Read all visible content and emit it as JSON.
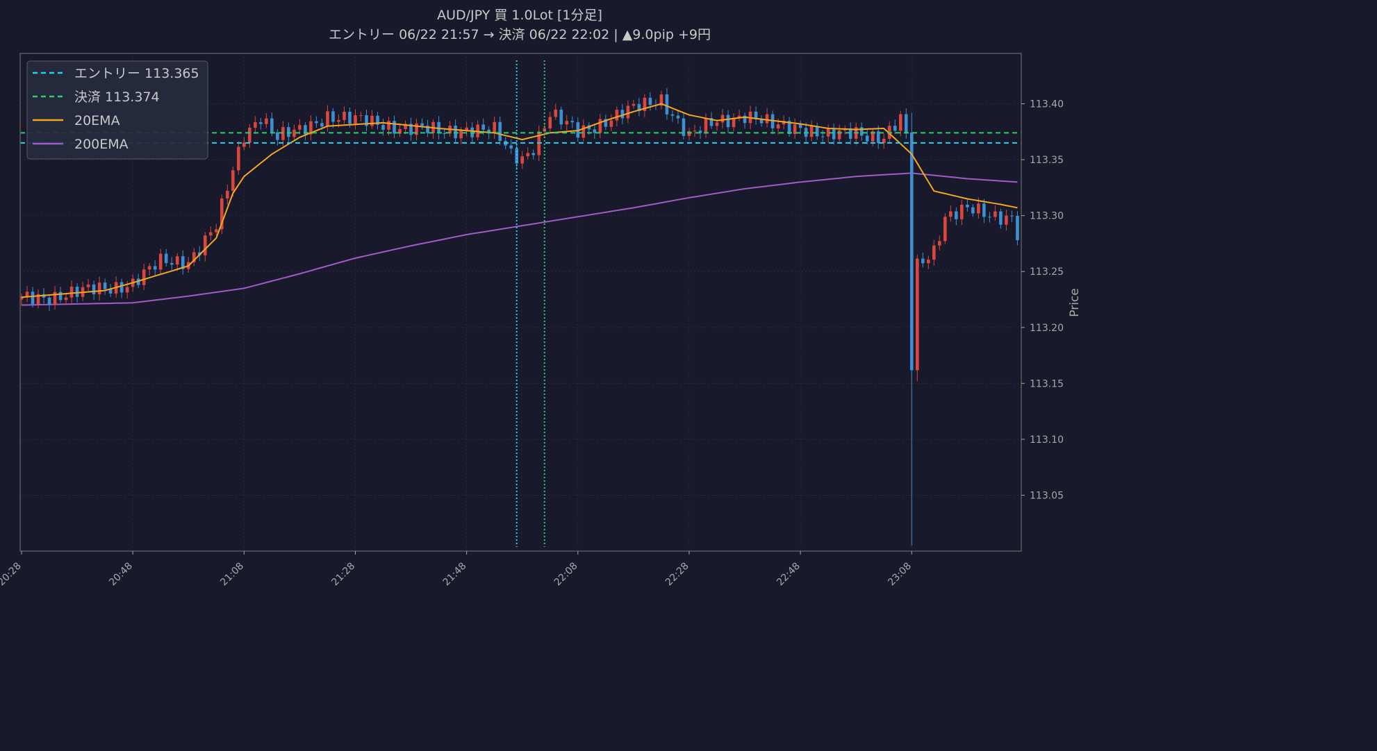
{
  "colors": {
    "background": "#181a2b",
    "plot_border": "#5a5a5a",
    "grid": "#2c2f44",
    "text": "#c9c9c9",
    "tick_text": "#a8a8a8",
    "bull": "#d9473f",
    "bear": "#3f8fd0",
    "entry": "#22d3ee",
    "exit": "#2ecc71",
    "ema20": "#f5a623",
    "ema200": "#a05cc8",
    "legend_bg": "#262a3d",
    "legend_border": "#55596b"
  },
  "chart_data": {
    "type": "candlestick",
    "title": "AUD/JPY 買 1.0Lot [1分足]",
    "subtitle": "エントリー 06/22 21:57 → 決済 06/22 22:02 | ▲9.0pip +9円",
    "xlabel": "",
    "ylabel": "Price",
    "ylim": [
      113.0,
      113.445
    ],
    "y_ticks": [
      113.05,
      113.1,
      113.15,
      113.2,
      113.25,
      113.3,
      113.35,
      113.4
    ],
    "y_tick_labels": [
      "113.05",
      "113.10",
      "113.15",
      "113.20",
      "113.25",
      "113.30",
      "113.35",
      "113.40"
    ],
    "x_start_time": "20:28",
    "x_ticks": [
      "20:28",
      "20:48",
      "21:08",
      "21:28",
      "21:48",
      "22:08",
      "22:28",
      "22:48",
      "23:08"
    ],
    "grid": true,
    "legend_position": "top-left",
    "legend": [
      {
        "label": "エントリー 113.365",
        "style": "dashed",
        "color_key": "entry"
      },
      {
        "label": "決済 113.374",
        "style": "dashed",
        "color_key": "exit"
      },
      {
        "label": "20EMA",
        "style": "solid",
        "color_key": "ema20"
      },
      {
        "label": "200EMA",
        "style": "solid",
        "color_key": "ema200"
      }
    ],
    "entry_price": 113.365,
    "exit_price": 113.374,
    "entry_time": "21:57",
    "exit_time": "22:02",
    "close_anchors": [
      [
        "20:28",
        113.225
      ],
      [
        "20:33",
        113.228
      ],
      [
        "20:38",
        113.231
      ],
      [
        "20:43",
        113.235
      ],
      [
        "20:48",
        113.24
      ],
      [
        "20:53",
        113.258
      ],
      [
        "20:58",
        113.26
      ],
      [
        "21:03",
        113.29
      ],
      [
        "21:06",
        113.34
      ],
      [
        "21:08",
        113.372
      ],
      [
        "21:11",
        113.39
      ],
      [
        "21:14",
        113.37
      ],
      [
        "21:18",
        113.375
      ],
      [
        "21:23",
        113.39
      ],
      [
        "21:28",
        113.385
      ],
      [
        "21:33",
        113.382
      ],
      [
        "21:38",
        113.378
      ],
      [
        "21:43",
        113.375
      ],
      [
        "21:48",
        113.378
      ],
      [
        "21:53",
        113.375
      ],
      [
        "21:56",
        113.355
      ],
      [
        "21:58",
        113.352
      ],
      [
        "22:00",
        113.362
      ],
      [
        "22:03",
        113.39
      ],
      [
        "22:08",
        113.375
      ],
      [
        "22:13",
        113.385
      ],
      [
        "22:18",
        113.395
      ],
      [
        "22:23",
        113.405
      ],
      [
        "22:28",
        113.37
      ],
      [
        "22:33",
        113.385
      ],
      [
        "22:38",
        113.39
      ],
      [
        "22:43",
        113.38
      ],
      [
        "22:48",
        113.38
      ],
      [
        "22:53",
        113.37
      ],
      [
        "22:58",
        113.375
      ],
      [
        "23:03",
        113.37
      ],
      [
        "23:06",
        113.385
      ],
      [
        "23:07",
        113.37
      ],
      [
        "23:08",
        113.165
      ],
      [
        "23:09",
        113.255
      ],
      [
        "23:12",
        113.27
      ],
      [
        "23:14",
        113.3
      ],
      [
        "23:18",
        113.305
      ],
      [
        "23:22",
        113.3
      ],
      [
        "23:26",
        113.3
      ],
      [
        "23:27",
        113.285
      ]
    ],
    "ema20_anchors": [
      [
        "20:28",
        113.227
      ],
      [
        "20:43",
        113.233
      ],
      [
        "20:48",
        113.24
      ],
      [
        "20:58",
        113.255
      ],
      [
        "21:03",
        113.28
      ],
      [
        "21:06",
        113.32
      ],
      [
        "21:08",
        113.335
      ],
      [
        "21:13",
        113.355
      ],
      [
        "21:18",
        113.37
      ],
      [
        "21:23",
        113.38
      ],
      [
        "21:33",
        113.383
      ],
      [
        "21:43",
        113.378
      ],
      [
        "21:53",
        113.374
      ],
      [
        "21:58",
        113.368
      ],
      [
        "22:03",
        113.374
      ],
      [
        "22:08",
        113.376
      ],
      [
        "22:13",
        113.385
      ],
      [
        "22:18",
        113.393
      ],
      [
        "22:23",
        113.4
      ],
      [
        "22:28",
        113.39
      ],
      [
        "22:33",
        113.385
      ],
      [
        "22:38",
        113.388
      ],
      [
        "22:43",
        113.385
      ],
      [
        "22:48",
        113.382
      ],
      [
        "22:53",
        113.378
      ],
      [
        "22:58",
        113.377
      ],
      [
        "23:03",
        113.378
      ],
      [
        "23:08",
        113.355
      ],
      [
        "23:12",
        113.322
      ],
      [
        "23:18",
        113.315
      ],
      [
        "23:24",
        113.31
      ],
      [
        "23:27",
        113.307
      ]
    ],
    "ema200_anchors": [
      [
        "20:28",
        113.22
      ],
      [
        "20:48",
        113.222
      ],
      [
        "20:58",
        113.228
      ],
      [
        "21:08",
        113.235
      ],
      [
        "21:18",
        113.248
      ],
      [
        "21:28",
        113.262
      ],
      [
        "21:38",
        113.273
      ],
      [
        "21:48",
        113.283
      ],
      [
        "21:58",
        113.291
      ],
      [
        "22:08",
        113.299
      ],
      [
        "22:18",
        113.307
      ],
      [
        "22:28",
        113.316
      ],
      [
        "22:38",
        113.324
      ],
      [
        "22:48",
        113.33
      ],
      [
        "22:58",
        113.335
      ],
      [
        "23:08",
        113.338
      ],
      [
        "23:18",
        113.333
      ],
      [
        "23:27",
        113.33
      ]
    ]
  }
}
